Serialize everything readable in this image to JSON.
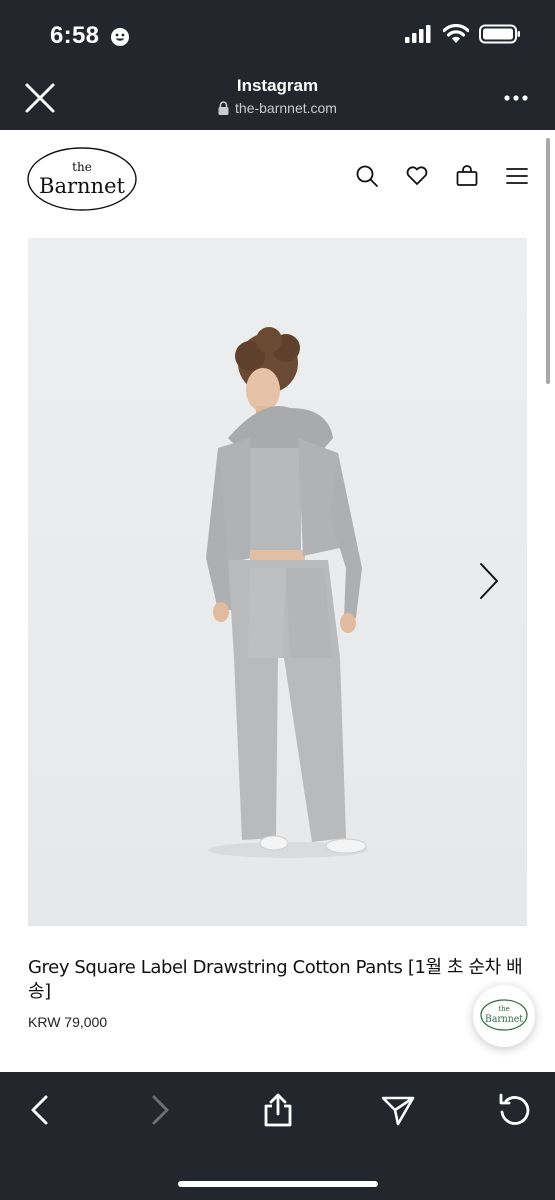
{
  "status_bar": {
    "time": "6:58"
  },
  "browser": {
    "title": "Instagram",
    "url": "the-barnnet.com"
  },
  "site": {
    "logo_text_small": "the",
    "logo_text_large": "Barnnet"
  },
  "product": {
    "title": "Grey Square Label Drawstring Cotton Pants [1월 초 순차 배송]",
    "price": "KRW 79,000"
  },
  "chat": {
    "logo_small": "the",
    "logo_large": "Barnnet"
  },
  "colors": {
    "chrome_bg": "#23262d",
    "image_bg": "#eceef0",
    "text": "#111111"
  }
}
